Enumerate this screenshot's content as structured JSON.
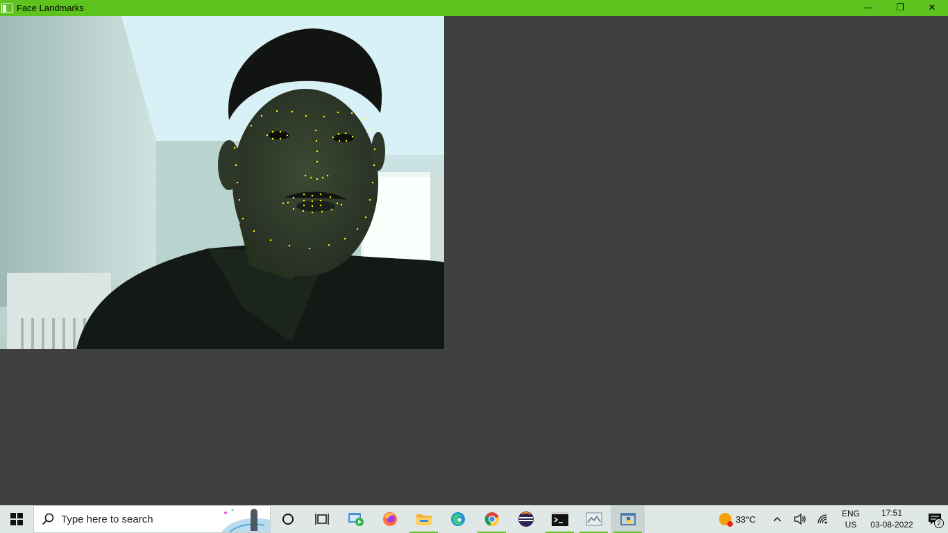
{
  "window": {
    "title": "Face Landmarks",
    "minimize_glyph": "—",
    "restore_glyph": "❐",
    "close_glyph": "✕"
  },
  "taskbar": {
    "search_placeholder": "Type here to search",
    "pinned_apps": [
      {
        "name": "cortana-icon",
        "active": false
      },
      {
        "name": "task-view-icon",
        "active": false
      },
      {
        "name": "video-editor-icon",
        "active": false
      },
      {
        "name": "firefox-icon",
        "active": false
      },
      {
        "name": "file-explorer-icon",
        "active": true
      },
      {
        "name": "edge-icon",
        "active": false
      },
      {
        "name": "chrome-icon",
        "active": true
      },
      {
        "name": "eclipse-icon",
        "active": false
      },
      {
        "name": "terminal-icon",
        "active": true
      },
      {
        "name": "photos-icon",
        "active": true
      },
      {
        "name": "python-icon",
        "active": true
      }
    ],
    "weather_temp": "33°C",
    "language_line1": "ENG",
    "language_line2": "US",
    "time": "17:51",
    "date": "03-08-2022",
    "notification_count": "2"
  },
  "colors": {
    "titlebar": "#5ec31f",
    "background": "#404040",
    "landmark": "#ffff00"
  }
}
